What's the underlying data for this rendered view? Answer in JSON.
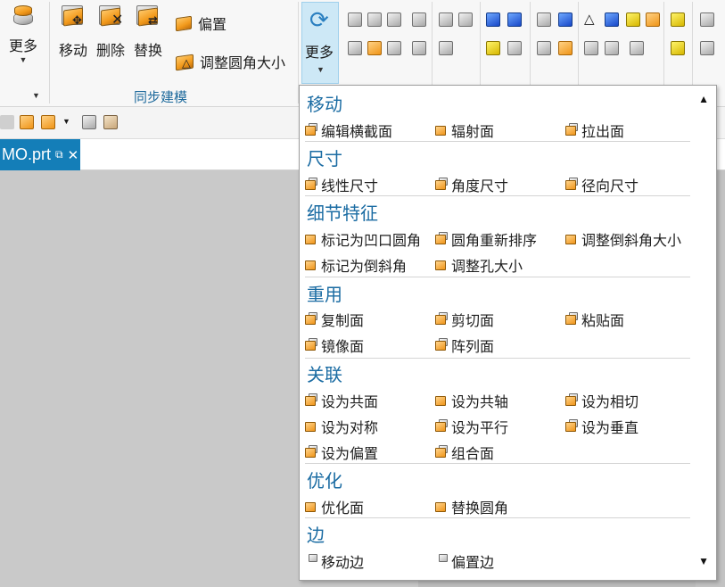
{
  "ribbon": {
    "more_left": "更多",
    "move": "移动",
    "delete": "删除",
    "replace": "替换",
    "offset": "偏置",
    "resize_blend": "调整圆角大小",
    "group_label": "同步建模",
    "more_right": "更多"
  },
  "tab": {
    "title": "MO.prt",
    "close": "✕"
  },
  "panel": {
    "scroll_up": "▲",
    "scroll_down": "▼",
    "categories": [
      {
        "title": "移动",
        "items": [
          "编辑横截面",
          "辐射面",
          "拉出面"
        ]
      },
      {
        "title": "尺寸",
        "items": [
          "线性尺寸",
          "角度尺寸",
          "径向尺寸"
        ]
      },
      {
        "title": "细节特征",
        "items": [
          "标记为凹口圆角",
          "圆角重新排序",
          "调整倒斜角大小",
          "标记为倒斜角",
          "调整孔大小"
        ]
      },
      {
        "title": "重用",
        "items": [
          "复制面",
          "剪切面",
          "粘贴面",
          "镜像面",
          "阵列面"
        ]
      },
      {
        "title": "关联",
        "items": [
          "设为共面",
          "设为共轴",
          "设为相切",
          "设为对称",
          "设为平行",
          "设为垂直",
          "设为偏置",
          "组合面"
        ]
      },
      {
        "title": "优化",
        "items": [
          "优化面",
          "替换圆角"
        ]
      },
      {
        "title": "边",
        "items": [
          "移动边",
          "偏置边"
        ]
      }
    ]
  },
  "icons": {
    "more": "cylinder-stack-icon",
    "move": "move-face-icon",
    "delete": "delete-face-icon",
    "replace": "replace-face-icon",
    "offset": "offset-region-icon",
    "resize_blend": "resize-blend-icon",
    "refresh": "refresh-icon"
  },
  "colors": {
    "accent": "#1b6ca3",
    "tab_bg": "#147eb8",
    "more_highlight": "#cde8f6"
  }
}
